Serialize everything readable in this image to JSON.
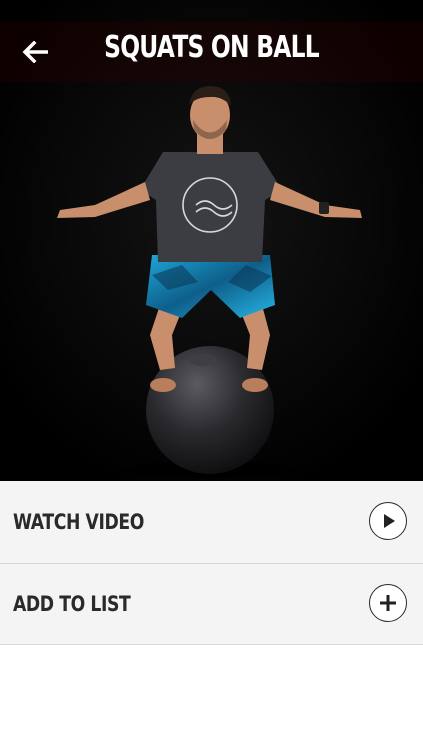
{
  "header": {
    "title": "SQUATS ON BALL",
    "back_icon": "arrow-left-icon"
  },
  "hero": {
    "image": "man-squatting-on-stability-ball-photo",
    "background_color": "#050505"
  },
  "actions": [
    {
      "label": "WATCH VIDEO",
      "icon": "play-icon"
    },
    {
      "label": "ADD TO LIST",
      "icon": "plus-icon"
    }
  ],
  "colors": {
    "list_background": "#f4f4f4",
    "text": "#2a2a2a",
    "divider": "#d8d8d8"
  }
}
